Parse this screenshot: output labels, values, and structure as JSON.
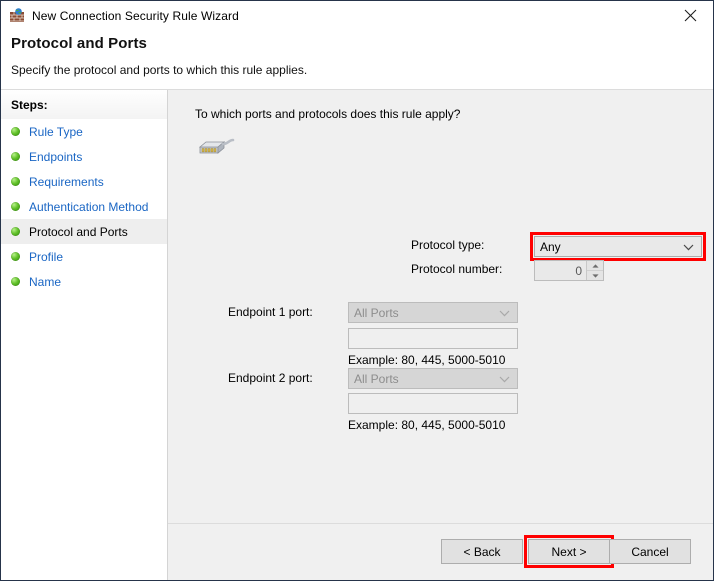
{
  "window": {
    "title": "New Connection Security Rule Wizard",
    "icon": "firewall-globe-icon",
    "close_label": "×"
  },
  "header": {
    "title": "Protocol and Ports",
    "subtitle": "Specify the protocol and ports to which this rule applies."
  },
  "sidebar": {
    "heading": "Steps:",
    "items": [
      {
        "label": "Rule Type",
        "current": false
      },
      {
        "label": "Endpoints",
        "current": false
      },
      {
        "label": "Requirements",
        "current": false
      },
      {
        "label": "Authentication Method",
        "current": false
      },
      {
        "label": "Protocol and Ports",
        "current": true
      },
      {
        "label": "Profile",
        "current": false
      },
      {
        "label": "Name",
        "current": false
      }
    ]
  },
  "main": {
    "question": "To which ports and protocols does this rule apply?",
    "protocol_icon": "network-connector-icon",
    "protocol_type": {
      "label": "Protocol type:",
      "value": "Any",
      "highlighted": true,
      "highlight_color": "#ff0000"
    },
    "protocol_number": {
      "label": "Protocol number:",
      "value": "0",
      "enabled": false
    },
    "endpoint1": {
      "label": "Endpoint 1 port:",
      "port_scope": "All Ports",
      "port_value": "",
      "hint": "Example: 80, 445, 5000-5010",
      "enabled": false
    },
    "endpoint2": {
      "label": "Endpoint 2 port:",
      "port_scope": "All Ports",
      "port_value": "",
      "hint": "Example: 80, 445, 5000-5010",
      "enabled": false
    }
  },
  "footer": {
    "back_label": "< Back",
    "next_label": "Next >",
    "cancel_label": "Cancel",
    "next_highlighted": true,
    "highlight_color": "#ff0000"
  }
}
